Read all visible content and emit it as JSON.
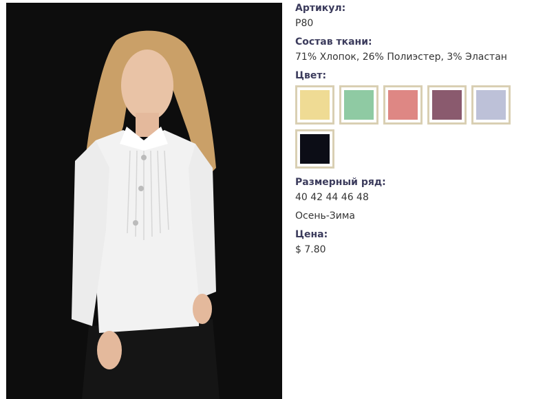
{
  "product": {
    "sku_label": "Артикул:",
    "sku_value": "P80",
    "fabric_label": "Состав ткани:",
    "fabric_value": "71% Хлопок, 26% Полиэстер, 3% Эластан",
    "color_label": "Цвет:",
    "colors": [
      {
        "hex": "#efdb94"
      },
      {
        "hex": "#8fcaa3"
      },
      {
        "hex": "#de8784"
      },
      {
        "hex": "#8a5a6e"
      },
      {
        "hex": "#bdc1d8"
      },
      {
        "hex": "#0c0d16"
      }
    ],
    "size_label": "Размерный ряд:",
    "size_value": "40 42 44 46 48",
    "season": "Осень-Зима",
    "price_label": "Цена:",
    "price_value": "$ 7.80"
  },
  "icons": {
    "photo": "product-photo-model-white-blouse"
  }
}
